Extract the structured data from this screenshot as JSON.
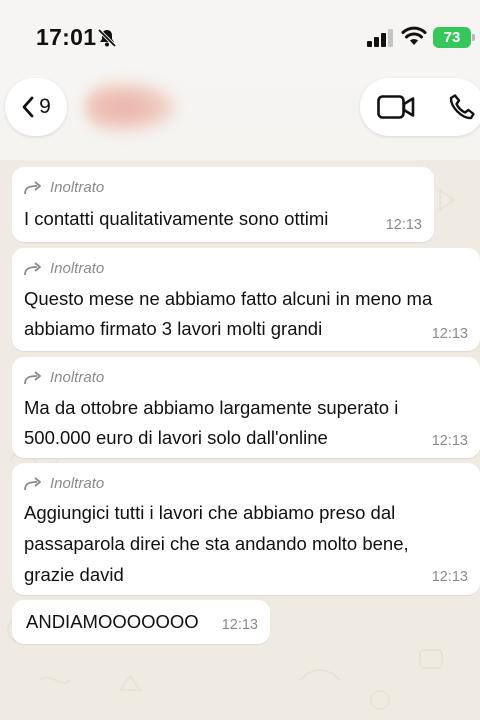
{
  "status_bar": {
    "time": "17:01",
    "battery": "73"
  },
  "header": {
    "back_count": "9"
  },
  "messages": [
    {
      "forwarded_label": "Inoltrato",
      "text": "I contatti qualitativamente sono ottimi",
      "time": "12:13"
    },
    {
      "forwarded_label": "Inoltrato",
      "line1": "Questo mese ne abbiamo fatto alcuni in meno ma",
      "line2": "abbiamo firmato 3 lavori molti grandi",
      "time": "12:13"
    },
    {
      "forwarded_label": "Inoltrato",
      "line1": "Ma da ottobre abbiamo largamente superato i",
      "line2": "500.000 euro di lavori solo dall'online",
      "time": "12:13"
    },
    {
      "forwarded_label": "Inoltrato",
      "line1": "Aggiungici tutti i lavori che abbiamo preso dal",
      "line2": "passaparola direi che sta andando molto bene,",
      "line3": "grazie david",
      "time": "12:13"
    },
    {
      "text": "ANDIAMOOOOOOO",
      "time": "12:13"
    }
  ]
}
